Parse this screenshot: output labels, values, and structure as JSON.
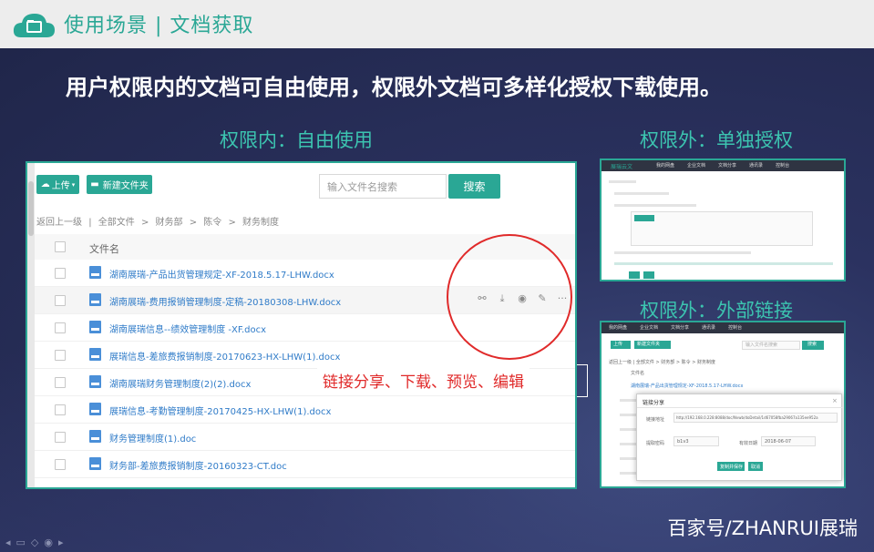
{
  "header": {
    "title": "使用场景 | 文档获取",
    "logo_icon": "cloud-folder-icon",
    "accent": "#2aa795"
  },
  "headline": "用户权限内的文档可自由使用，权限外文档可多样化授权下载使用。",
  "sections": {
    "inside": "权限内：自由使用",
    "outside_auth": "权限外：单独授权",
    "outside_link": "权限外：外部链接"
  },
  "main_panel": {
    "upload_label": "上传",
    "new_folder_label": "新建文件夹",
    "search_placeholder": "输入文件名搜索",
    "search_label": "搜索",
    "breadcrumb": [
      "返回上一级",
      "|",
      "全部文件",
      ">",
      "财务部",
      ">",
      "陈令",
      ">",
      "财务制度"
    ],
    "column_name": "文件名",
    "files": [
      "湖南展瑞-产品出货管理规定-XF-2018.5.17-LHW.docx",
      "湖南展瑞-费用报销管理制度-定稿-20180308-LHW.docx",
      "湖南展瑞信息--绩效管理制度 -XF.docx",
      "展瑞信息-差旅费报销制度-20170623-HX-LHW(1).docx",
      "湖南展瑞财务管理制度(2)(2).docx",
      "展瑞信息-考勤管理制度-20170425-HX-LHW(1).docx",
      "财务管理制度(1).doc",
      "财务部-差旅费报销制度-20160323-CT.doc"
    ],
    "row_actions": [
      "link-icon",
      "download-icon",
      "preview-icon",
      "edit-icon",
      "more-icon"
    ]
  },
  "callout": "链接分享、下载、预览、编辑",
  "thumb_auth": {
    "logo": "展瑞云文",
    "nav": [
      "我的网盘",
      "企业文档",
      "文档分享",
      "通讯录",
      "控制台"
    ]
  },
  "thumb_link": {
    "nav": [
      "我的网盘",
      "企业文档",
      "文档分享",
      "通讯录",
      "控制台"
    ],
    "upload": "上传",
    "new_folder": "新建文件夹",
    "search_placeholder": "输入文件名搜索",
    "search": "搜索",
    "breadcrumb": "返回上一级 | 全部文件 > 财务部 > 陈令 > 财务制度",
    "column_name": "文件名",
    "first_file": "湖南展瑞-产品出货管理规定-XF-2018.5.17-LHW.docx",
    "modal_title": "链接分享",
    "modal_link_label": "链接地址",
    "modal_link_value": "http://192.168.0.228:8088/doc/Nvwb/doDetail/1d67058fba29067a135ee952a",
    "modal_code_label": "提取密码",
    "modal_code_value": "b1v3",
    "modal_expiry_label": "有效日期",
    "modal_expiry_value": "2018-06-07",
    "modal_copy": "复制并保存",
    "modal_close": "取消"
  },
  "watermark": "百家号/ZHANRUI展瑞"
}
